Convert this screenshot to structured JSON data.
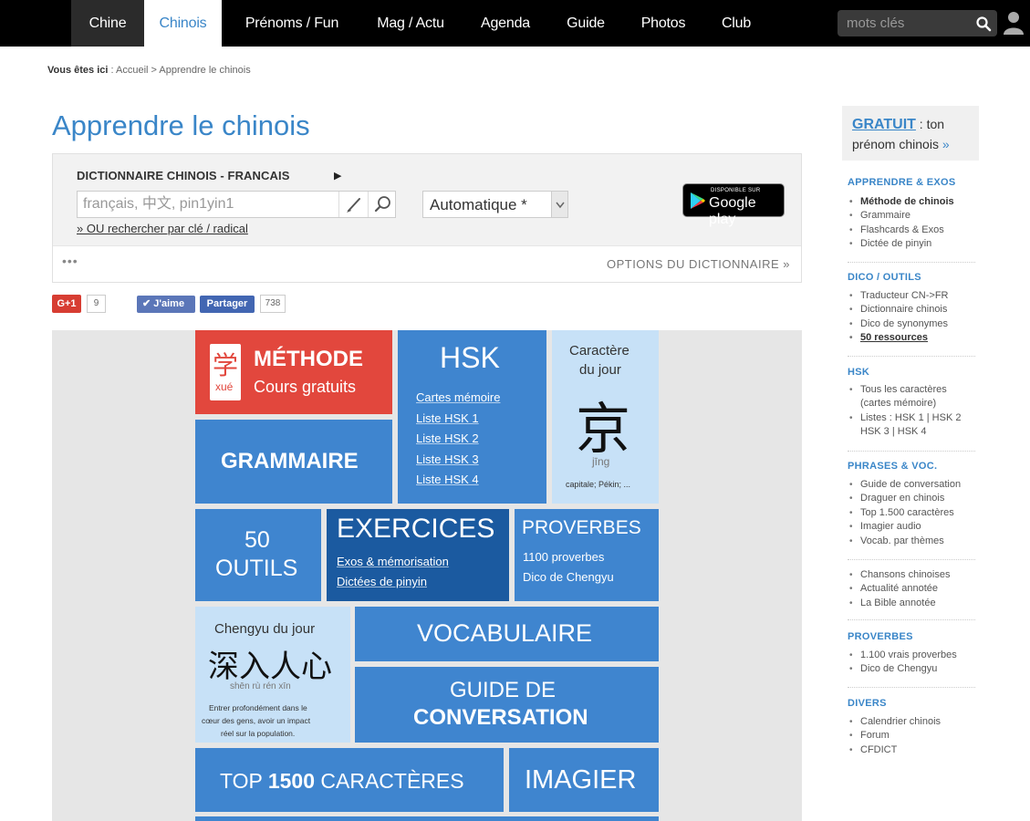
{
  "nav": {
    "items": [
      "Chine",
      "Chinois",
      "Prénoms / Fun",
      "Mag / Actu",
      "Agenda",
      "Guide",
      "Photos",
      "Club"
    ],
    "search_placeholder": "mots clés"
  },
  "breadcrumb": {
    "label": "Vous êtes ici",
    "sep": " : ",
    "home": "Accueil",
    "arrow": " > ",
    "current": "Apprendre le chinois"
  },
  "page_title": "Apprendre le chinois",
  "dictionary": {
    "title": "DICTIONNAIRE CHINOIS - FRANCAIS",
    "arrow": "▶",
    "input_placeholder": "français, 中文, pin1yin1",
    "radical_link": "» OU rechercher par clé / radical",
    "mode": "Automatique *",
    "google_play_small": "DISPONIBLE SUR",
    "google_play_big": "Google play",
    "more": "•••",
    "options": "OPTIONS DU DICTIONNAIRE »"
  },
  "social": {
    "gplus": "G+1",
    "gplus_count": "9",
    "fb_like": "✔ J'aime",
    "fb_share": "Partager",
    "fb_count": "738"
  },
  "tiles": {
    "methode": {
      "glyph": "学",
      "pinyin": "xué",
      "title": "MÉTHODE",
      "subtitle": "Cours gratuits"
    },
    "hsk": {
      "title": "HSK",
      "links": [
        "Cartes mémoire",
        "Liste HSK 1",
        "Liste HSK 2",
        "Liste HSK 3",
        "Liste HSK 4"
      ]
    },
    "caractere": {
      "title1": "Caractère",
      "title2": "du jour",
      "char": "京",
      "pinyin": "jīng",
      "meaning": "capitale; Pékin; ..."
    },
    "grammaire": {
      "title": "GRAMMAIRE"
    },
    "outils": {
      "line1": "50",
      "line2": "OUTILS"
    },
    "exercices": {
      "title": "EXERCICES",
      "links": [
        "Exos & mémorisation",
        "Dictées de pinyin"
      ]
    },
    "proverbes": {
      "title": "PROVERBES",
      "links": [
        "1100 proverbes",
        "Dico de Chengyu"
      ]
    },
    "chengyu": {
      "title": "Chengyu du jour",
      "chars": "深入人心",
      "pinyin": "shēn rù rén xīn",
      "desc1": "Entrer profondément dans le",
      "desc2": "cœur des gens, avoir un impact",
      "desc3": "réel sur la population."
    },
    "vocabulaire": {
      "title": "VOCABULAIRE"
    },
    "guide": {
      "line1": "GUIDE DE",
      "line2": "CONVERSATION"
    },
    "top": {
      "pre": "TOP ",
      "num": "1500",
      "post": " CARACTÈRES"
    },
    "imagier": {
      "title": "IMAGIER"
    }
  },
  "sidebar": {
    "gratuit": {
      "link": "GRATUIT",
      "rest": " : ton",
      "line2": "prénom chinois",
      "arrow": " »"
    },
    "sections": [
      {
        "head": "APPRENDRE & EXOS",
        "items": [
          "Méthode de chinois",
          "Grammaire",
          "Flashcards & Exos",
          "Dictée de pinyin"
        ]
      },
      {
        "head": "DICO / OUTILS",
        "items": [
          "Traducteur CN->FR",
          "Dictionnaire chinois",
          "Dico de synonymes",
          "50 ressources"
        ]
      },
      {
        "head": "HSK",
        "items": [
          "Tous les caractères",
          "(cartes mémoire)",
          "Listes : HSK 1 | HSK 2",
          "HSK 3 | HSK 4"
        ]
      },
      {
        "head": "PHRASES & VOC.",
        "items": [
          "Guide de conversation",
          "Draguer en chinois",
          "Top 1.500 caractères",
          "Imagier audio",
          "Vocab. par thèmes"
        ]
      },
      {
        "head": "",
        "items": [
          "Chansons chinoises",
          "Actualité annotée",
          "La Bible annotée"
        ]
      },
      {
        "head": "PROVERBES",
        "items": [
          "1.100 vrais proverbes",
          "Dico de Chengyu"
        ]
      },
      {
        "head": "DIVERS",
        "items": [
          "Calendrier chinois",
          "Forum",
          "CFDICT"
        ]
      }
    ]
  },
  "colors": {
    "nav_bg": "#000000",
    "accent": "#3a86c8",
    "tile_blue": "#3f85cf",
    "tile_dark": "#1b5aa0",
    "tile_red": "#e2473d",
    "tile_light": "#c7e1f7"
  }
}
